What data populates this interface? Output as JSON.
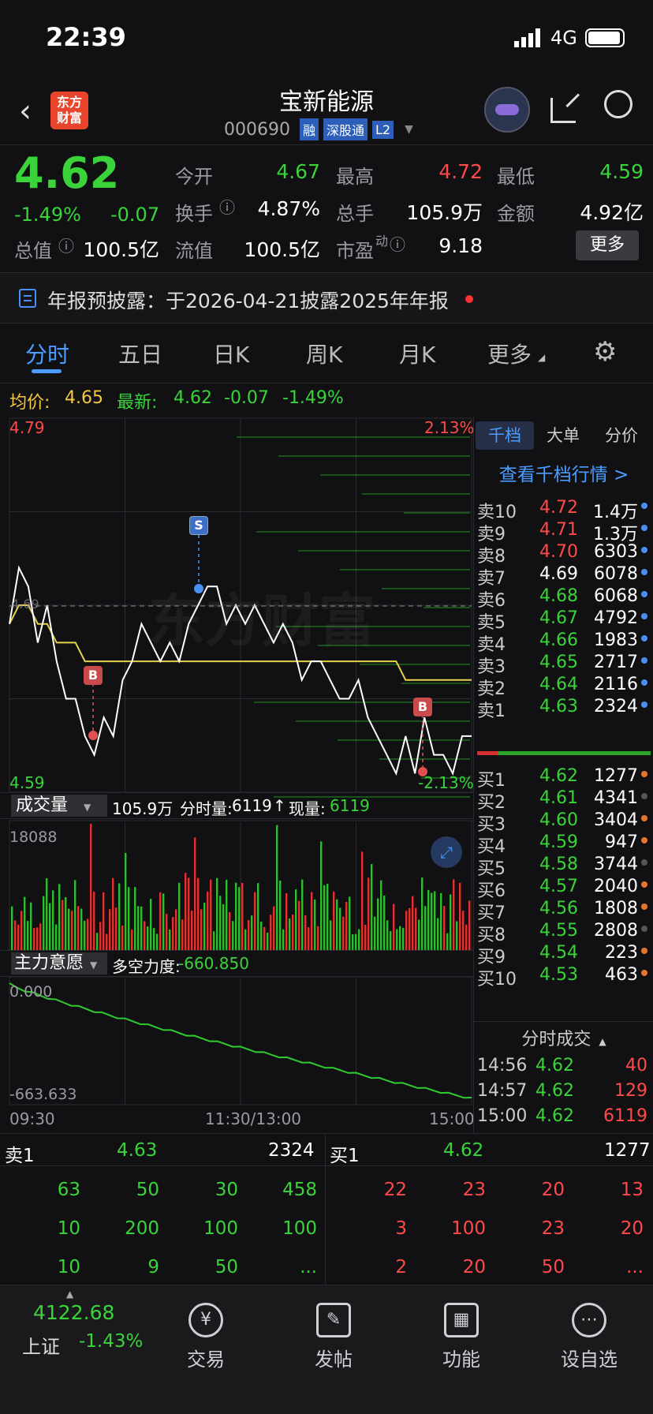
{
  "status_bar": {
    "time": "22:39",
    "network": "4G"
  },
  "header": {
    "logo_line1": "东方",
    "logo_line2": "财富",
    "title": "宝新能源",
    "code": "000690",
    "badge_rong": "融",
    "badge_sgt": "深股通",
    "badge_l2": "L2"
  },
  "quote": {
    "price": "4.62",
    "change_pct": "-1.49%",
    "change": "-0.07",
    "open_label": "今开",
    "open": "4.67",
    "high_label": "最高",
    "high": "4.72",
    "low_label": "最低",
    "low": "4.59",
    "turnover_label": "换手",
    "turnover": "4.87%",
    "volume_label": "总手",
    "volume": "105.9万",
    "amount_label": "金额",
    "amount": "4.92亿",
    "mktcap_label": "总值",
    "mktcap": "100.5亿",
    "float_label": "流值",
    "float": "100.5亿",
    "pe_label": "市盈",
    "pe_sup": "动",
    "pe": "9.18",
    "more_button": "更多"
  },
  "notice": {
    "text": "年报预披露：于2026-04-21披露2025年年报"
  },
  "tabs": {
    "items": [
      "分时",
      "五日",
      "日K",
      "周K",
      "月K",
      "更多"
    ],
    "active": 0
  },
  "info_line": {
    "avg_label": "均价:",
    "avg": "4.65",
    "latest_label": "最新:",
    "latest": "4.62",
    "chg": "-0.07",
    "pct": "-1.49%"
  },
  "chart": {
    "y_top": "4.79",
    "y_bottom": "4.59",
    "pct_top": "2.13%",
    "pct_bottom": "-2.13%",
    "mid_label": "4.69",
    "watermark": "东方财富",
    "vol_selector": "成交量",
    "vol_total": "105.9万",
    "vol_fenshi_label": "分时量:",
    "vol_fenshi": "6119",
    "vol_now_label": "现量:",
    "vol_now": "6119",
    "vol_max": "18088",
    "ind_selector": "主力意愿",
    "ind_label": "多空力度:",
    "ind_value": "-660.850",
    "ind_top": "0.000",
    "ind_bottom": "-663.633",
    "x_start": "09:30",
    "x_mid": "11:30/13:00",
    "x_end": "15:00",
    "marker_s": "S",
    "marker_b": "B"
  },
  "chart_data": {
    "type": "line",
    "series": [
      {
        "name": "",
        "values": [
          4.68,
          4.71,
          4.7,
          4.67,
          4.69,
          4.66,
          4.64,
          4.64,
          4.62,
          4.61,
          4.63,
          4.62,
          4.65,
          4.66,
          4.68,
          4.67,
          4.66,
          4.67,
          4.66,
          4.68,
          4.69,
          4.7,
          4.7,
          4.68,
          4.69,
          4.68,
          4.69,
          4.68,
          4.67,
          4.68,
          4.67,
          4.65,
          4.66,
          4.66,
          4.65,
          4.64,
          4.64,
          4.65,
          4.63,
          4.62,
          4.61,
          4.6,
          4.62,
          4.6,
          4.63,
          4.61,
          4.61,
          4.6,
          4.62,
          4.62
        ]
      },
      {
        "name": "",
        "values": [
          4.68,
          4.69,
          4.69,
          4.68,
          4.68,
          4.67,
          4.67,
          4.67,
          4.66,
          4.66,
          4.66,
          4.66,
          4.66,
          4.66,
          4.66,
          4.66,
          4.66,
          4.66,
          4.66,
          4.66,
          4.66,
          4.66,
          4.66,
          4.66,
          4.66,
          4.66,
          4.66,
          4.66,
          4.66,
          4.66,
          4.66,
          4.66,
          4.66,
          4.66,
          4.66,
          4.66,
          4.66,
          4.66,
          4.66,
          4.66,
          4.66,
          4.66,
          4.65,
          4.65,
          4.65,
          4.65,
          4.65,
          4.65,
          4.65,
          4.65
        ]
      }
    ],
    "ylim": [
      4.59,
      4.79
    ]
  },
  "orderbook": {
    "tabs": [
      "千档",
      "大单",
      "分价"
    ],
    "link": "查看千档行情 >",
    "asks": [
      {
        "label": "卖10",
        "price": "4.72",
        "vol": "1.4万"
      },
      {
        "label": "卖9",
        "price": "4.71",
        "vol": "1.3万"
      },
      {
        "label": "卖8",
        "price": "4.70",
        "vol": "6303"
      },
      {
        "label": "卖7",
        "price": "4.69",
        "vol": "6078"
      },
      {
        "label": "卖6",
        "price": "4.68",
        "vol": "6068"
      },
      {
        "label": "卖5",
        "price": "4.67",
        "vol": "4792"
      },
      {
        "label": "卖4",
        "price": "4.66",
        "vol": "1983"
      },
      {
        "label": "卖3",
        "price": "4.65",
        "vol": "2717"
      },
      {
        "label": "卖2",
        "price": "4.64",
        "vol": "2116"
      },
      {
        "label": "卖1",
        "price": "4.63",
        "vol": "2324"
      }
    ],
    "bids": [
      {
        "label": "买1",
        "price": "4.62",
        "vol": "1277"
      },
      {
        "label": "买2",
        "price": "4.61",
        "vol": "4341"
      },
      {
        "label": "买3",
        "price": "4.60",
        "vol": "3404"
      },
      {
        "label": "买4",
        "price": "4.59",
        "vol": "947"
      },
      {
        "label": "买5",
        "price": "4.58",
        "vol": "3744"
      },
      {
        "label": "买6",
        "price": "4.57",
        "vol": "2040"
      },
      {
        "label": "买7",
        "price": "4.56",
        "vol": "1808"
      },
      {
        "label": "买8",
        "price": "4.55",
        "vol": "2808"
      },
      {
        "label": "买9",
        "price": "4.54",
        "vol": "223"
      },
      {
        "label": "买10",
        "price": "4.53",
        "vol": "463"
      }
    ],
    "ticks_title": "分时成交",
    "ticks": [
      {
        "time": "14:56",
        "price": "4.62",
        "vol": "40"
      },
      {
        "time": "14:57",
        "price": "4.62",
        "vol": "129"
      },
      {
        "time": "15:00",
        "price": "4.62",
        "vol": "6119"
      }
    ]
  },
  "queue": {
    "sell_label": "卖1",
    "sell_price": "4.63",
    "sell_vol": "2324",
    "buy_label": "买1",
    "buy_price": "4.62",
    "buy_vol": "1277",
    "sell_rows": [
      [
        "63",
        "50",
        "30",
        "458"
      ],
      [
        "10",
        "200",
        "100",
        "100"
      ],
      [
        "10",
        "9",
        "50",
        "..."
      ]
    ],
    "buy_rows": [
      [
        "22",
        "23",
        "20",
        "13"
      ],
      [
        "3",
        "100",
        "23",
        "20"
      ],
      [
        "2",
        "20",
        "50",
        "..."
      ]
    ]
  },
  "bottom_nav": {
    "index_value": "4122.68",
    "index_name": "上证",
    "index_pct": "-1.43%",
    "items": [
      "交易",
      "发帖",
      "功能",
      "设自选"
    ]
  }
}
